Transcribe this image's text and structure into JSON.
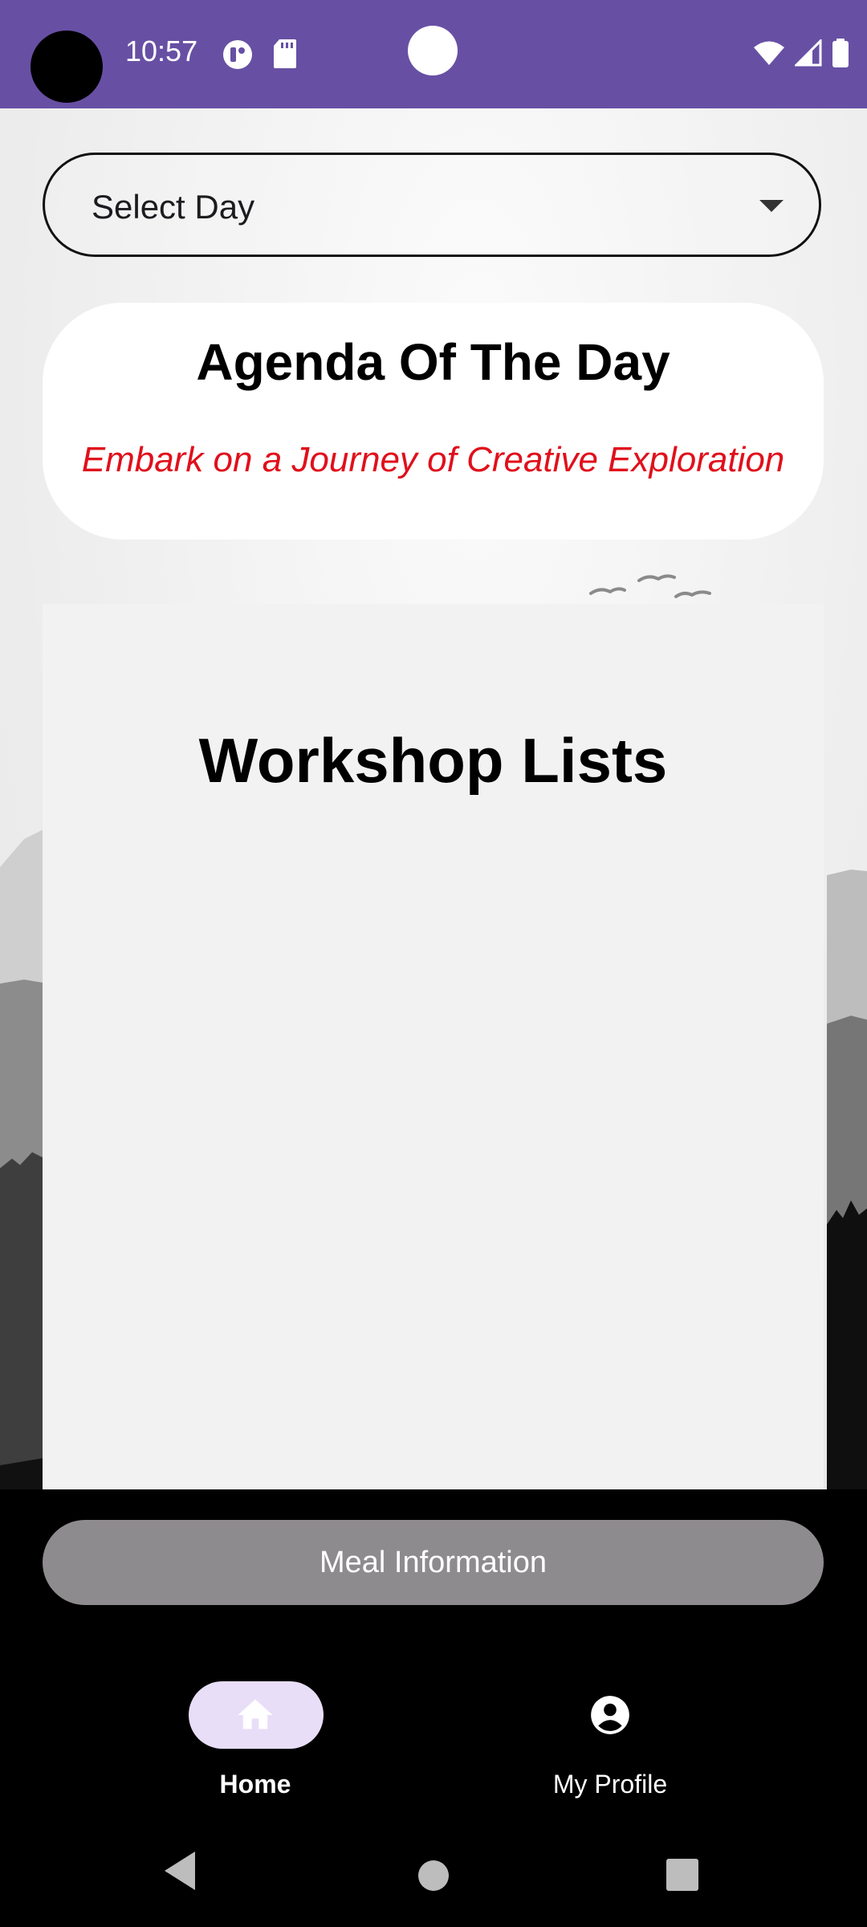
{
  "status_bar": {
    "time": "10:57",
    "background_color": "#6750a4",
    "icons": [
      "app-notification-icon",
      "sd-card-icon",
      "wifi-icon",
      "cell-signal-icon",
      "battery-icon"
    ]
  },
  "day_select": {
    "selected_label": "Select Day",
    "icon": "dropdown-arrow-icon"
  },
  "agenda": {
    "title": "Agenda Of The Day",
    "subtitle": "Embark on a Journey of Creative Exploration",
    "subtitle_color": "#e0101b"
  },
  "workshops": {
    "title": "Workshop Lists",
    "items": []
  },
  "meal_button": {
    "label": "Meal Information",
    "color": "#8e8b8e"
  },
  "bottom_nav": {
    "items": [
      {
        "label": "Home",
        "icon": "home-icon",
        "selected": true
      },
      {
        "label": "My Profile",
        "icon": "account-circle-icon",
        "selected": false
      }
    ],
    "selected_pill_color": "#e8def8"
  },
  "system_nav": {
    "buttons": [
      "back-icon",
      "home-circle-icon",
      "recents-icon"
    ]
  }
}
